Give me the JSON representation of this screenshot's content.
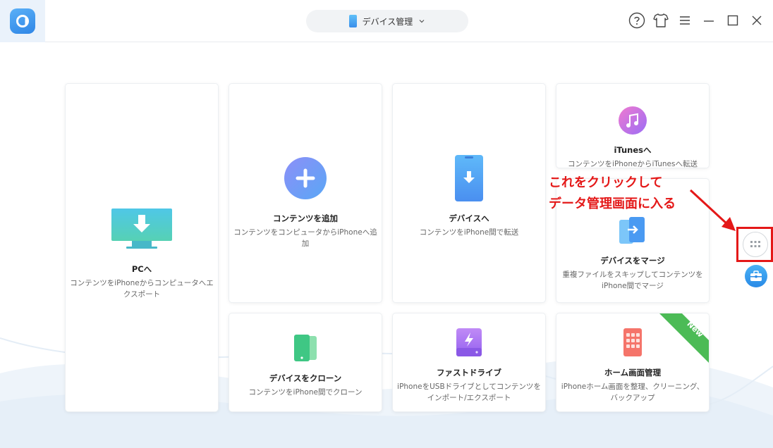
{
  "header": {
    "device_selector_label": "デバイス管理"
  },
  "cards": {
    "to_pc": {
      "title": "PCへ",
      "desc": "コンテンツをiPhoneからコンピュータへエクスポート"
    },
    "add_content": {
      "title": "コンテンツを追加",
      "desc": "コンテンツをコンピュータからiPhoneへ追加"
    },
    "to_device": {
      "title": "デバイスへ",
      "desc": "コンテンツをiPhone間で転送"
    },
    "to_itunes": {
      "title": "iTunesへ",
      "desc": "コンテンツをiPhoneからiTunesへ転送"
    },
    "merge_device": {
      "title": "デバイスをマージ",
      "desc": "重複ファイルをスキップしてコンテンツをiPhone間でマージ"
    },
    "clone_device": {
      "title": "デバイスをクローン",
      "desc": "コンテンツをiPhone間でクローン"
    },
    "fast_drive": {
      "title": "ファストドライブ",
      "desc": "iPhoneをUSBドライブとしてコンテンツをインポート/エクスポート"
    },
    "home_screen": {
      "title": "ホーム画面管理",
      "desc": "iPhoneホーム画面を整理、クリーニング、バックアップ",
      "badge": "New"
    }
  },
  "annotation": {
    "line1": "これをクリックして",
    "line2": "データ管理画面に入る"
  },
  "colors": {
    "accent": "#3a8eea",
    "annotation_red": "#e41818",
    "new_badge_green": "#4cbb56"
  },
  "icons": [
    "app-logo-icon",
    "phone-icon",
    "chevron-down-icon",
    "help-icon",
    "skin-icon",
    "menu-icon",
    "minimize-icon",
    "maximize-icon",
    "close-icon",
    "monitor-download-icon",
    "plus-circle-icon",
    "phone-download-icon",
    "music-note-icon",
    "merge-phones-icon",
    "clone-phones-icon",
    "usb-drive-icon",
    "home-screen-icon",
    "grid-icon",
    "toolbox-icon",
    "arrow-icon"
  ]
}
